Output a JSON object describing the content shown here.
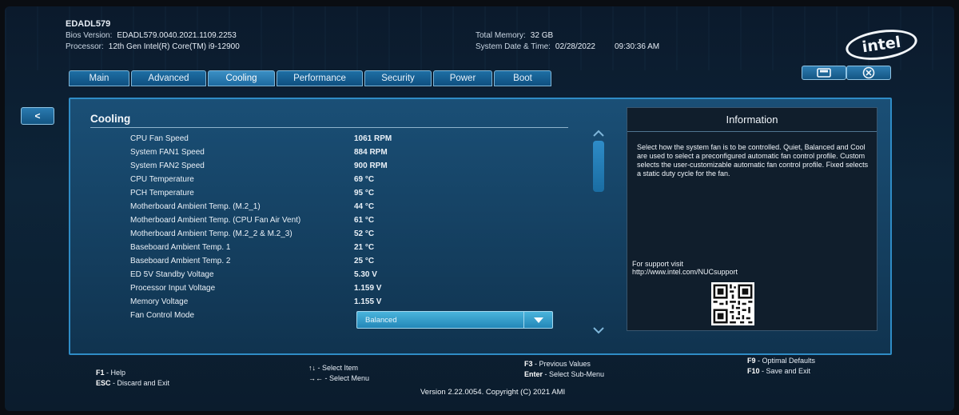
{
  "header": {
    "system_name": "EDADL579",
    "bios_version_label": "Bios Version:",
    "bios_version_value": "EDADL579.0040.2021.1109.2253",
    "processor_label": "Processor:",
    "processor_value": "12th Gen Intel(R) Core(TM) i9-12900",
    "total_memory_label": "Total Memory:",
    "total_memory_value": "32 GB",
    "date_time_label": "System Date & Time:",
    "date_value": "02/28/2022",
    "time_value": "09:30:36 AM",
    "logo_text": "intel"
  },
  "tabs": [
    {
      "label": "Main"
    },
    {
      "label": "Advanced"
    },
    {
      "label": "Cooling"
    },
    {
      "label": "Performance"
    },
    {
      "label": "Security"
    },
    {
      "label": "Power"
    },
    {
      "label": "Boot"
    }
  ],
  "active_tab": "Cooling",
  "toolbar": {
    "save_icon": "save-icon",
    "exit_icon": "close-circle-icon",
    "back_label": "<"
  },
  "section": {
    "title": "Cooling",
    "rows": [
      {
        "label": "CPU Fan Speed",
        "value": "1061 RPM"
      },
      {
        "label": "System FAN1 Speed",
        "value": "884 RPM"
      },
      {
        "label": "System FAN2 Speed",
        "value": "900 RPM"
      },
      {
        "label": "CPU Temperature",
        "value": "69 °C"
      },
      {
        "label": "PCH Temperature",
        "value": "95 °C"
      },
      {
        "label": "Motherboard Ambient Temp. (M.2_1)",
        "value": "44 °C"
      },
      {
        "label": "Motherboard Ambient Temp. (CPU Fan Air Vent)",
        "value": "61 °C"
      },
      {
        "label": "Motherboard Ambient Temp. (M.2_2 & M.2_3)",
        "value": "52 °C"
      },
      {
        "label": "Baseboard Ambient Temp. 1",
        "value": "21 °C"
      },
      {
        "label": "Baseboard Ambient Temp. 2",
        "value": "25 °C"
      },
      {
        "label": "ED 5V Standby Voltage",
        "value": "5.30 V"
      },
      {
        "label": "Processor Input Voltage",
        "value": "1.159 V"
      },
      {
        "label": "Memory Voltage",
        "value": "1.155 V"
      }
    ],
    "fan_control_label": "Fan Control Mode",
    "fan_control_value": "Balanced"
  },
  "info": {
    "title": "Information",
    "text": "Select how the system fan is to be controlled. Quiet, Balanced and Cool are used to select a preconfigured automatic fan control profile. Custom selects the user-customizable automatic fan control profile. Fixed selects a static duty cycle for the fan.",
    "support_label": "For support visit",
    "support_url": "http://www.intel.com/NUCsupport"
  },
  "footer": {
    "f1": "F1",
    "f1_text": "- Help",
    "esc": "ESC",
    "esc_text": "- Discard and Exit",
    "nav_keys": "↑↓",
    "nav_text": "- Select Item",
    "menu_keys": "→←",
    "menu_text": "- Select Menu",
    "f3": "F3",
    "f3_text": "- Previous Values",
    "enter": "Enter",
    "enter_text": "- Select Sub-Menu",
    "f9": "F9",
    "f9_text": "- Optimal Defaults",
    "f10": "F10",
    "f10_text": "- Save and Exit",
    "copyright": "Version 2.22.0054. Copyright (C) 2021 AMI"
  },
  "colors": {
    "accent": "#2f8cc6",
    "tab_active": "#3b8fc4",
    "background": "#0d2438"
  }
}
